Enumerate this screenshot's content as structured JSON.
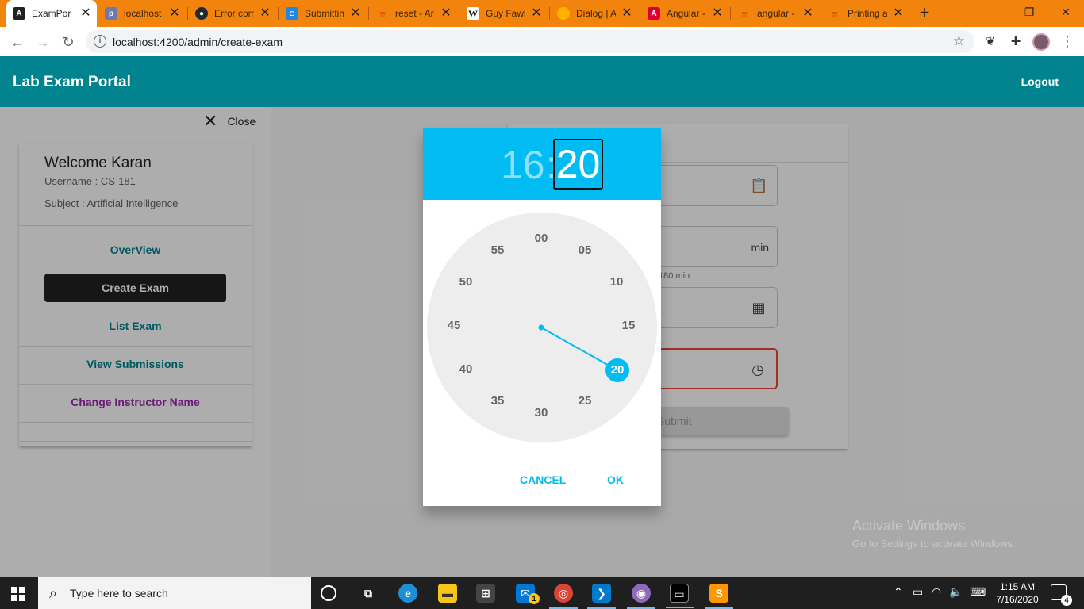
{
  "browser": {
    "tabs": [
      {
        "title": "ExamPortal",
        "icon": "angular-icon",
        "color": "#222222"
      },
      {
        "title": "localhost",
        "icon": "phpmyadmin-icon",
        "color": "#6c78af"
      },
      {
        "title": "Error com",
        "icon": "github-icon",
        "color": "#24292e"
      },
      {
        "title": "Submittin",
        "icon": "discord-icon",
        "color": "#1e88e5"
      },
      {
        "title": "reset - Ar",
        "icon": "stackoverflow-icon",
        "color": "#f48024"
      },
      {
        "title": "Guy Fawk",
        "icon": "wikipedia-icon",
        "color": "#111111"
      },
      {
        "title": "Dialog | A",
        "icon": "material-icon",
        "color": "#ffb300"
      },
      {
        "title": "Angular -",
        "icon": "angular-red-icon",
        "color": "#dd0031"
      },
      {
        "title": "angular -",
        "icon": "stackoverflow-icon",
        "color": "#f48024"
      },
      {
        "title": "Printing a",
        "icon": "stackoverflow-icon",
        "color": "#f48024"
      }
    ],
    "url": "localhost:4200/admin/create-exam"
  },
  "app": {
    "title": "Lab Exam Portal",
    "logout": "Logout",
    "close": "Close",
    "profile": {
      "welcome": "Welcome Karan",
      "username": "Username : CS-181",
      "subject": "Subject : Artificial Intelligence"
    },
    "nav": {
      "overview": "OverView",
      "create_exam": "Create Exam",
      "list_exam": "List Exam",
      "view_submissions": "View Submissions",
      "change_name": "Change Instructor Name"
    },
    "form": {
      "duration_suffix": "min",
      "duration_hint": "180 min",
      "submit": "Submit"
    }
  },
  "time_picker": {
    "hour": "16",
    "separator": ":",
    "minute": "20",
    "selected_minute": "20",
    "dial_numbers": [
      "00",
      "05",
      "10",
      "15",
      "25",
      "30",
      "35",
      "40",
      "45",
      "50",
      "55"
    ],
    "cancel": "CANCEL",
    "ok": "OK",
    "accent": "#00bcf2"
  },
  "watermark": {
    "line1": "Activate Windows",
    "line2": "Go to Settings to activate Windows."
  },
  "taskbar": {
    "search_placeholder": "Type here to search",
    "mail_badge": "1",
    "time": "1:15 AM",
    "date": "7/16/2020",
    "notification_count": "4"
  }
}
